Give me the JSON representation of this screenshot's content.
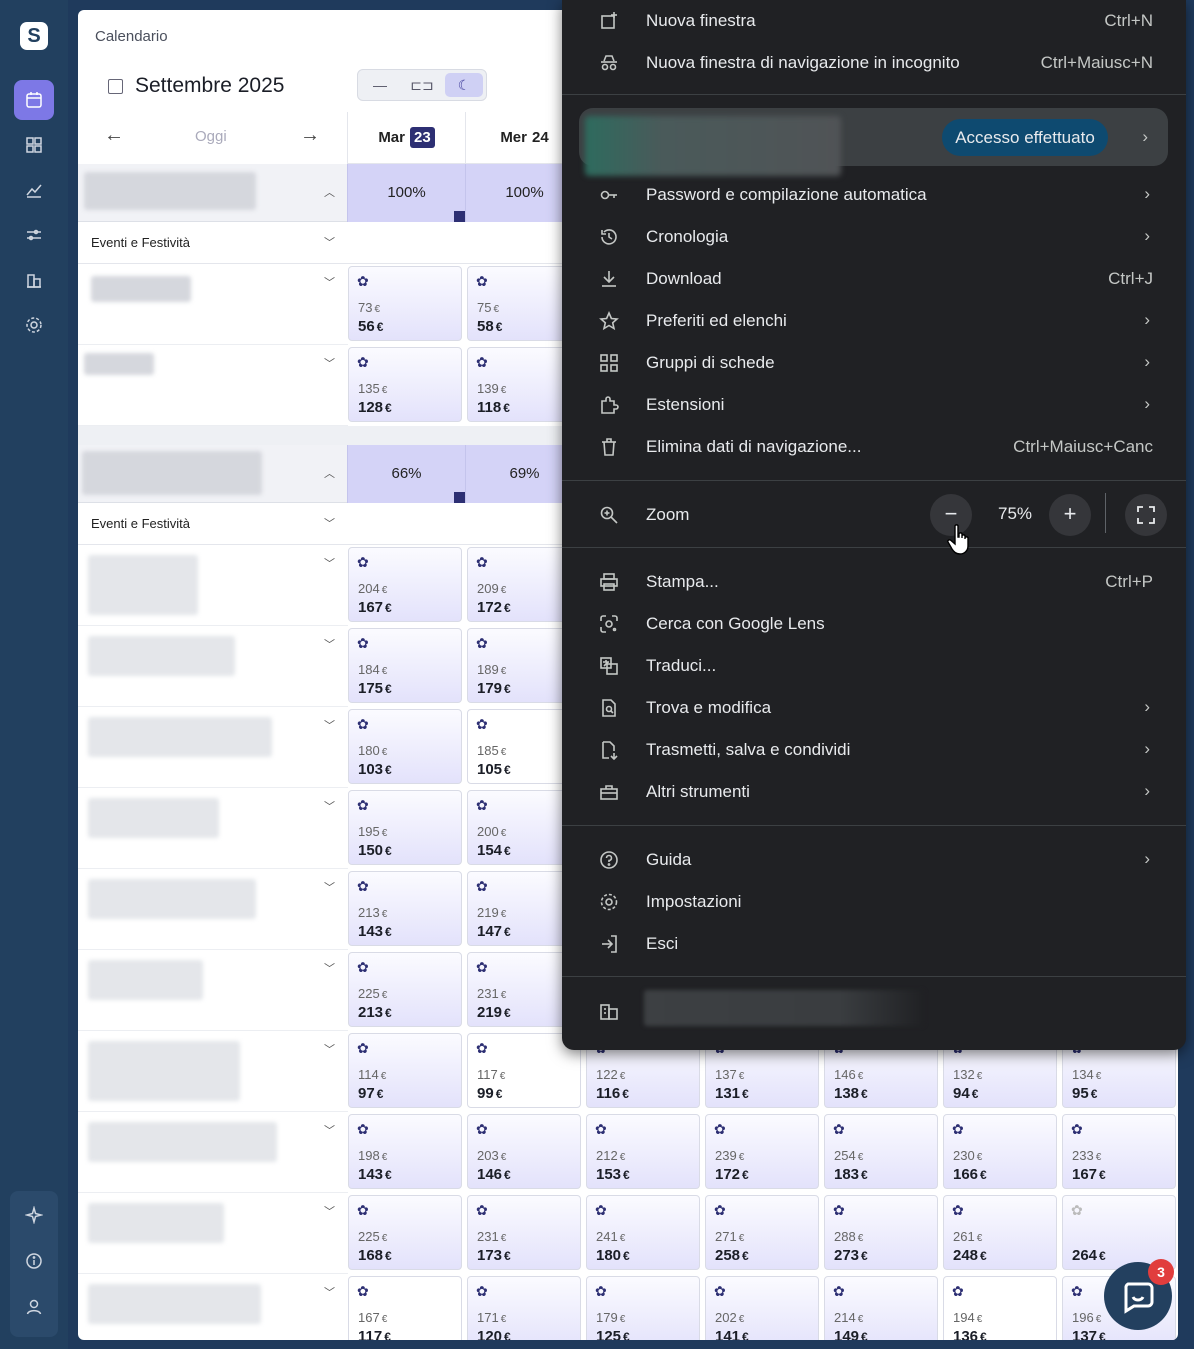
{
  "calendar": {
    "breadcrumb": "Calendario",
    "month_label": "Settembre 2025",
    "today_label": "Oggi",
    "days": [
      {
        "name": "Mar",
        "num": "23"
      },
      {
        "name": "Mer",
        "num": "24"
      }
    ],
    "sections": [
      {
        "occupancy": [
          "100%",
          "100%"
        ],
        "events_label": "Eventi e Festività"
      },
      {
        "occupancy": [
          "66%",
          "69%"
        ],
        "events_label": "Eventi e Festività"
      }
    ],
    "currency": "€",
    "section1_cells": [
      [
        {
          "a": "73",
          "b": "56"
        },
        {
          "a": "75",
          "b": "58"
        }
      ],
      [
        {
          "a": "135",
          "b": "128"
        },
        {
          "a": "139",
          "b": "118"
        }
      ]
    ],
    "section2_left_cells": [
      [
        {
          "a": "204",
          "b": "167"
        },
        {
          "a": "209",
          "b": "172"
        }
      ],
      [
        {
          "a": "184",
          "b": "175"
        },
        {
          "a": "189",
          "b": "179"
        }
      ],
      [
        {
          "a": "180",
          "b": "103"
        },
        {
          "a": "185",
          "b": "105"
        }
      ],
      [
        {
          "a": "195",
          "b": "150"
        },
        {
          "a": "200",
          "b": "154"
        }
      ],
      [
        {
          "a": "213",
          "b": "143"
        },
        {
          "a": "219",
          "b": "147"
        }
      ],
      [
        {
          "a": "225",
          "b": "213"
        },
        {
          "a": "231",
          "b": "219"
        }
      ]
    ],
    "full_rows": [
      [
        {
          "a": "114",
          "b": "97"
        },
        {
          "a": "117",
          "b": "99"
        },
        {
          "a": "122",
          "b": "116"
        },
        {
          "a": "137",
          "b": "131"
        },
        {
          "a": "146",
          "b": "138"
        },
        {
          "a": "132",
          "b": "94"
        },
        {
          "a": "134",
          "b": "95"
        }
      ],
      [
        {
          "a": "198",
          "b": "143"
        },
        {
          "a": "203",
          "b": "146"
        },
        {
          "a": "212",
          "b": "153"
        },
        {
          "a": "239",
          "b": "172"
        },
        {
          "a": "254",
          "b": "183"
        },
        {
          "a": "230",
          "b": "166"
        },
        {
          "a": "233",
          "b": "167"
        }
      ],
      [
        {
          "a": "225",
          "b": "168"
        },
        {
          "a": "231",
          "b": "173"
        },
        {
          "a": "241",
          "b": "180"
        },
        {
          "a": "271",
          "b": "258"
        },
        {
          "a": "288",
          "b": "273"
        },
        {
          "a": "261",
          "b": "248"
        },
        {
          "a": "",
          "b": "264"
        }
      ],
      [
        {
          "a": "167",
          "b": "117"
        },
        {
          "a": "171",
          "b": "120"
        },
        {
          "a": "179",
          "b": "125"
        },
        {
          "a": "202",
          "b": "141"
        },
        {
          "a": "214",
          "b": "149"
        },
        {
          "a": "194",
          "b": "136"
        },
        {
          "a": "196",
          "b": "137"
        }
      ]
    ]
  },
  "menu": {
    "new_window": {
      "label": "Nuova finestra",
      "shortcut": "Ctrl+N"
    },
    "incognito": {
      "label": "Nuova finestra di navigazione in incognito",
      "shortcut": "Ctrl+Maiusc+N"
    },
    "profile_button": "Accesso effettuato",
    "passwords": "Password e compilazione automatica",
    "history": "Cronologia",
    "download": {
      "label": "Download",
      "shortcut": "Ctrl+J"
    },
    "bookmarks": "Preferiti ed elenchi",
    "tab_groups": "Gruppi di schede",
    "extensions": "Estensioni",
    "clear_data": {
      "label": "Elimina dati di navigazione...",
      "shortcut": "Ctrl+Maiusc+Canc"
    },
    "zoom": {
      "label": "Zoom",
      "value": "75%",
      "minus": "−",
      "plus": "+"
    },
    "print": {
      "label": "Stampa...",
      "shortcut": "Ctrl+P"
    },
    "lens": "Cerca con Google Lens",
    "translate": "Traduci...",
    "find_edit": "Trova e modifica",
    "cast_save": "Trasmetti, salva e condividi",
    "more_tools": "Altri strumenti",
    "help": "Guida",
    "settings": "Impostazioni",
    "exit": "Esci"
  },
  "help_widget": {
    "badge": "3"
  }
}
